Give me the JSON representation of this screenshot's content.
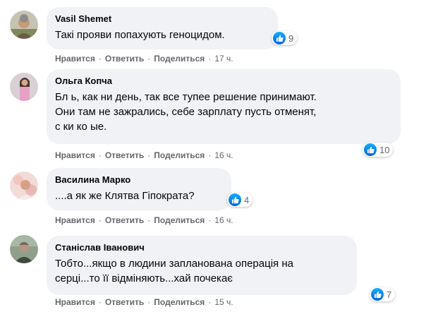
{
  "comments": [
    {
      "author": "Vasil Shemet",
      "text": "Такі прояви попахують геноцидом.",
      "reactions": "9",
      "actions": {
        "like": "Нравится",
        "reply": "Ответить",
        "share": "Поделиться"
      },
      "time": "17 ч."
    },
    {
      "author": "Ольга Копча",
      "text_lines": [
        "Бл  ь, как ни день, так все тупее решение принимают.",
        "Они там не зажрались, себе зарплату пусть отменят,",
        "с  ки ко    ые."
      ],
      "reactions": "10",
      "actions": {
        "like": "Нравится",
        "reply": "Ответить",
        "share": "Поделиться"
      },
      "time": "16 ч."
    },
    {
      "author": "Василина Марко",
      "text": "....а як же Клятва Гіпократа?",
      "reactions": "4",
      "actions": {
        "like": "Нравится",
        "reply": "Ответить",
        "share": "Поделиться"
      },
      "time": "16 ч."
    },
    {
      "author": "Станіслав Іванович",
      "text_lines": [
        "Тобто...якщо в людини запланована операція на",
        "серці...то її відміняють...хай почекає"
      ],
      "reactions": "7",
      "actions": {
        "like": "Нравится",
        "reply": "Ответить",
        "share": "Поделиться"
      },
      "time": "15 ч."
    }
  ],
  "separator": "·",
  "colors": {
    "bubble": "#f0f2f5",
    "like_blue": "#1877f2",
    "meta": "#65676b"
  }
}
